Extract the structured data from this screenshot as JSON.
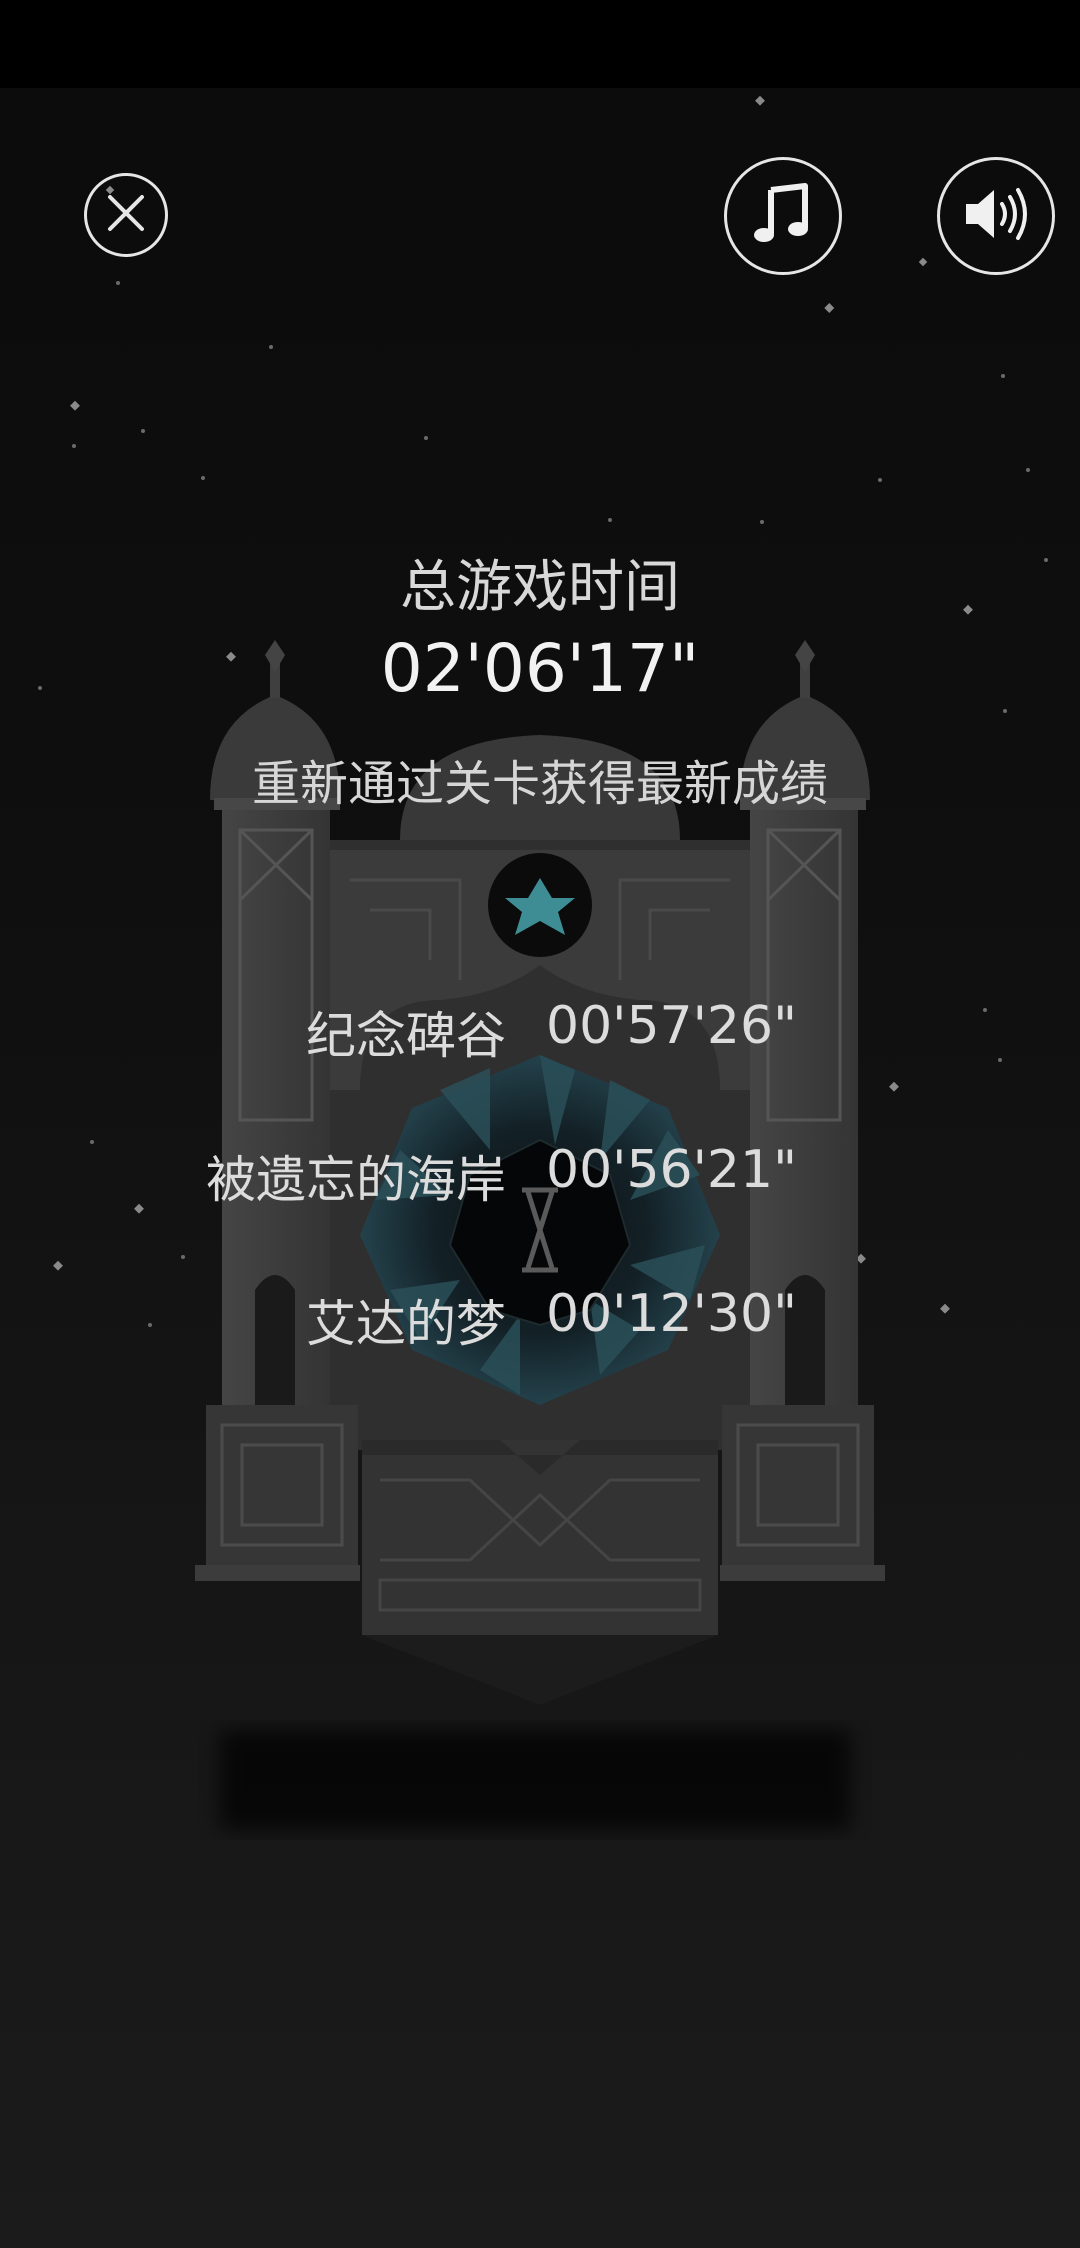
{
  "header": {
    "close_icon": "close-icon",
    "music_icon": "music-note-icon",
    "sound_icon": "speaker-icon"
  },
  "summary": {
    "title": "总游戏时间",
    "total_time": "02'06'17\"",
    "hint": "重新通过关卡获得最新成绩"
  },
  "levels": [
    {
      "name": "纪念碑谷",
      "time": "00'57'26\""
    },
    {
      "name": "被遗忘的海岸",
      "time": "00'56'21\""
    },
    {
      "name": "艾达的梦",
      "time": "00'12'30\""
    }
  ],
  "colors": {
    "background": "#0f0f0f",
    "text": "#e4e4e4",
    "monument": "#3a3a3a",
    "portal": "#1f3a44"
  }
}
